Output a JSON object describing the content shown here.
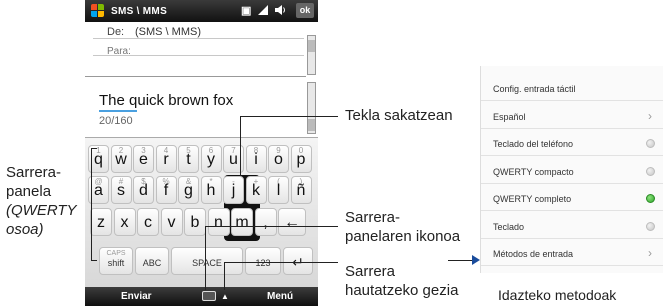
{
  "status_bar": {
    "title": "SMS \\ MMS",
    "ok_label": "ok"
  },
  "message": {
    "from_label": "De:",
    "from_value": "(SMS \\ MMS)",
    "to_label": "Para:",
    "body_text": "The quick brown fox",
    "char_counter": "20/160"
  },
  "keyboard": {
    "rows": [
      [
        {
          "main": "q",
          "alt": "1"
        },
        {
          "main": "w",
          "alt": "2"
        },
        {
          "main": "e",
          "alt": "3"
        },
        {
          "main": "r",
          "alt": "4"
        },
        {
          "main": "t",
          "alt": "5"
        },
        {
          "main": "y",
          "alt": "6"
        },
        {
          "main": "u",
          "alt": "7"
        },
        {
          "main": "i",
          "alt": "8"
        },
        {
          "main": "o",
          "alt": "9"
        },
        {
          "main": "p",
          "alt": "0"
        }
      ],
      [
        {
          "main": "a",
          "alt": "@"
        },
        {
          "main": "s",
          "alt": "#"
        },
        {
          "main": "d",
          "alt": "$"
        },
        {
          "main": "f",
          "alt": "%"
        },
        {
          "main": "g",
          "alt": "&"
        },
        {
          "main": "h",
          "alt": "*"
        },
        {
          "main": "j",
          "alt": "-"
        },
        {
          "main": "k",
          "alt": "+"
        },
        {
          "main": "l",
          "alt": "("
        },
        {
          "main": "ñ",
          "alt": ")"
        }
      ],
      [
        {
          "main": "z",
          "alt": ""
        },
        {
          "main": "x",
          "alt": ""
        },
        {
          "main": "c",
          "alt": ""
        },
        {
          "main": "v",
          "alt": ""
        },
        {
          "main": "b",
          "alt": ""
        },
        {
          "main": "n",
          "alt": ""
        },
        {
          "main": "m",
          "alt": ""
        },
        {
          "main": ",",
          "alt": ""
        },
        {
          "main": "←",
          "alt": ""
        }
      ]
    ],
    "caps_label": "CAPS",
    "shift_label": "shift",
    "abc_label": "ABC",
    "space_label": "SPACE",
    "num_label": "123",
    "enter_label": "↵",
    "pressed_key": "j"
  },
  "softkeys": {
    "left": "Enviar",
    "right": "Menú"
  },
  "callouts": {
    "key_press": "Tekla sakatzean",
    "panel_label_line1": "Sarrera-",
    "panel_label_line2": "panela",
    "panel_label_line3": "(QWERTY",
    "panel_label_line4": "osoa)",
    "panel_icon_line1": "Sarrera-",
    "panel_icon_line2": "panelaren ikonoa",
    "selector_line1": "Sarrera",
    "selector_line2": "hautatzeko gezia",
    "menu_caption": "Idazteko metodoak"
  },
  "input_menu": {
    "items": [
      {
        "label": "Config. entrada táctil",
        "indicator": "none"
      },
      {
        "label": "Español",
        "indicator": "chevron"
      },
      {
        "label": "Teclado del teléfono",
        "indicator": "off"
      },
      {
        "label": "QWERTY compacto",
        "indicator": "off"
      },
      {
        "label": "QWERTY completo",
        "indicator": "on"
      },
      {
        "label": "Teclado",
        "indicator": "off"
      },
      {
        "label": "Métodos de entrada",
        "indicator": "chevron"
      }
    ]
  },
  "colors": {
    "accent_underline": "#4aa0e0",
    "selected_dot": "#2ea62a"
  }
}
